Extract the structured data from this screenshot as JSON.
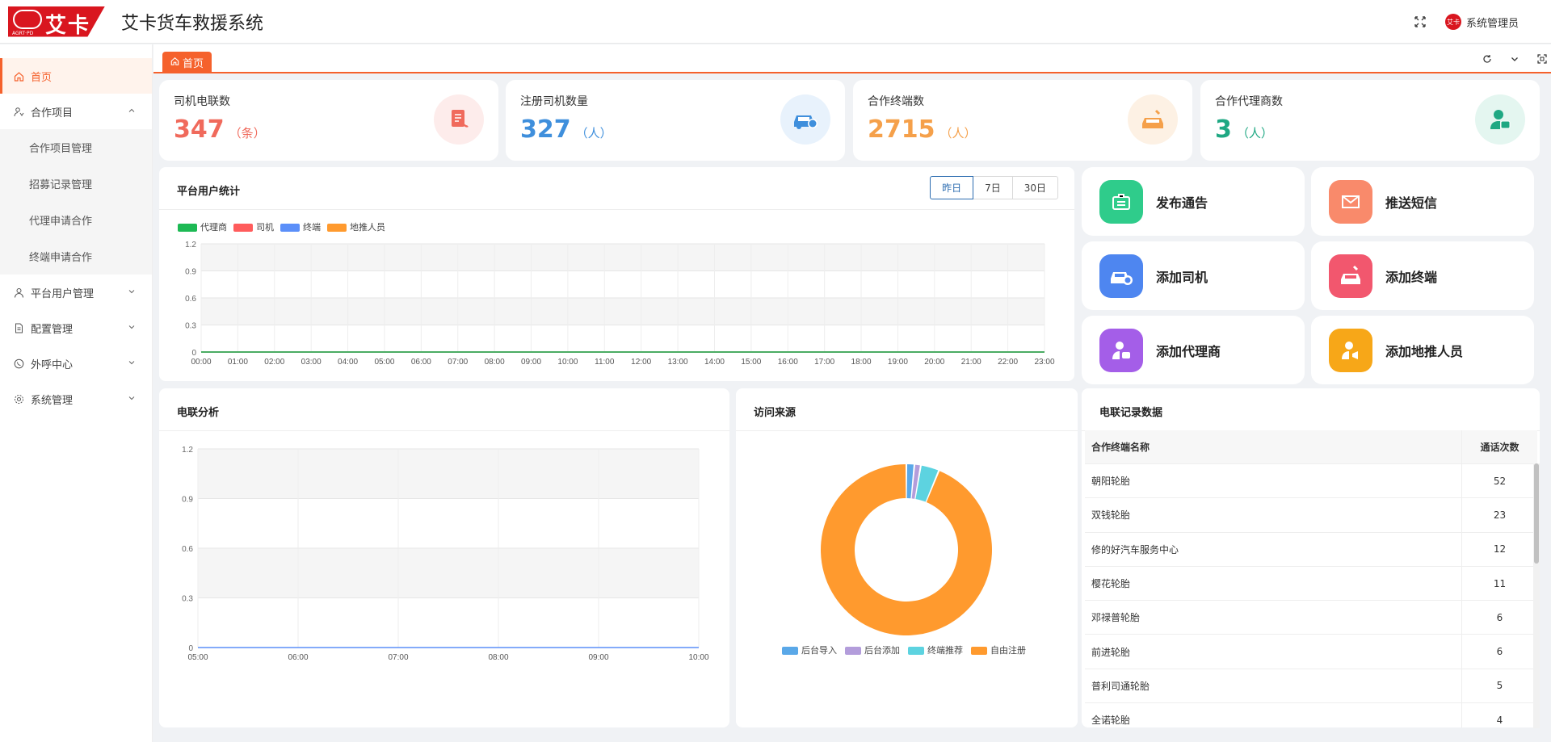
{
  "app": {
    "title": "艾卡货车救援系统",
    "logo_text": "艾卡",
    "logo_sub": "AGRT·PD",
    "user": "系统管理员",
    "user_badge": "艾卡"
  },
  "sidebar": {
    "items": [
      {
        "label": "首页"
      },
      {
        "label": "合作项目",
        "children": [
          "合作项目管理",
          "招募记录管理",
          "代理申请合作",
          "终端申请合作"
        ]
      },
      {
        "label": "平台用户管理"
      },
      {
        "label": "配置管理"
      },
      {
        "label": "外呼中心"
      },
      {
        "label": "系统管理"
      }
    ]
  },
  "tabs": [
    {
      "label": "首页"
    }
  ],
  "stats": [
    {
      "label": "司机电联数",
      "value": "347",
      "unit": "（条）",
      "color": "#f06a5c",
      "bg": "#fdeceb"
    },
    {
      "label": "注册司机数量",
      "value": "327",
      "unit": "（人）",
      "color": "#3f8fdc",
      "bg": "#e8f2fc"
    },
    {
      "label": "合作终端数",
      "value": "2715",
      "unit": "（人）",
      "color": "#f5a04a",
      "bg": "#fdf1e4"
    },
    {
      "label": "合作代理商数",
      "value": "3",
      "unit": "（人）",
      "color": "#1fa883",
      "bg": "#e4f6f0"
    }
  ],
  "user_stats": {
    "title": "平台用户统计",
    "ranges": [
      "昨日",
      "7日",
      "30日"
    ],
    "legend": [
      "代理商",
      "司机",
      "终端",
      "地推人员"
    ],
    "legend_colors": [
      "#1db954",
      "#ff5c5c",
      "#5b8ff9",
      "#ff9a2e"
    ]
  },
  "actions": [
    {
      "label": "发布通告",
      "color": "#2fcc8b",
      "icon": "notice-icon"
    },
    {
      "label": "推送短信",
      "color": "#f98a6b",
      "icon": "mail-icon"
    },
    {
      "label": "添加司机",
      "color": "#4e86f0",
      "icon": "car-icon"
    },
    {
      "label": "添加终端",
      "color": "#f2576e",
      "icon": "car-repair-icon"
    },
    {
      "label": "添加代理商",
      "color": "#a45ee8",
      "icon": "agent-icon"
    },
    {
      "label": "添加地推人员",
      "color": "#f7a718",
      "icon": "promoter-icon"
    }
  ],
  "call_analysis": {
    "title": "电联分析"
  },
  "visit_source": {
    "title": "访问来源",
    "legend": [
      "后台导入",
      "后台添加",
      "终端推荐",
      "自由注册"
    ],
    "legend_colors": [
      "#5aa8e8",
      "#b39ddb",
      "#5dd3e0",
      "#ff9a2e"
    ]
  },
  "call_records": {
    "title": "电联记录数据",
    "headers": [
      "合作终端名称",
      "通话次数"
    ],
    "rows": [
      [
        "朝阳轮胎",
        "52"
      ],
      [
        "双钱轮胎",
        "23"
      ],
      [
        "修的好汽车服务中心",
        "12"
      ],
      [
        "樱花轮胎",
        "11"
      ],
      [
        "邓禄普轮胎",
        "6"
      ],
      [
        "前进轮胎",
        "6"
      ],
      [
        "普利司通轮胎",
        "5"
      ],
      [
        "全诺轮胎",
        "4"
      ]
    ]
  },
  "chart_data": [
    {
      "type": "line",
      "title": "平台用户统计",
      "x": [
        "00:00",
        "01:00",
        "02:00",
        "03:00",
        "04:00",
        "05:00",
        "06:00",
        "07:00",
        "08:00",
        "09:00",
        "10:00",
        "11:00",
        "12:00",
        "13:00",
        "14:00",
        "15:00",
        "16:00",
        "17:00",
        "18:00",
        "19:00",
        "20:00",
        "21:00",
        "22:00",
        "23:00"
      ],
      "ylim": [
        0,
        1.2
      ],
      "yticks": [
        "1.2",
        "0.9",
        "0.6",
        "0.3",
        "0"
      ],
      "series": [
        {
          "name": "代理商",
          "values": [
            0,
            0,
            0,
            0,
            0,
            0,
            0,
            0,
            0,
            0,
            0,
            0,
            0,
            0,
            0,
            0,
            0,
            0,
            0,
            0,
            0,
            0,
            0,
            0
          ]
        },
        {
          "name": "司机",
          "values": [
            0,
            0,
            0,
            0,
            0,
            0,
            0,
            0,
            0,
            0,
            0,
            0,
            0,
            0,
            0,
            0,
            0,
            0,
            0,
            0,
            0,
            0,
            0,
            0
          ]
        },
        {
          "name": "终端",
          "values": [
            0,
            0,
            0,
            0,
            0,
            0,
            0,
            0,
            0,
            0,
            0,
            0,
            0,
            0,
            0,
            0,
            0,
            0,
            0,
            0,
            0,
            0,
            0,
            0
          ]
        },
        {
          "name": "地推人员",
          "values": [
            0,
            0,
            0,
            0,
            0,
            0,
            0,
            0,
            0,
            0,
            0,
            0,
            0,
            0,
            0,
            0,
            0,
            0,
            0,
            0,
            0,
            0,
            0,
            0
          ]
        }
      ]
    },
    {
      "type": "line",
      "title": "电联分析",
      "x": [
        "05:00",
        "06:00",
        "07:00",
        "08:00",
        "09:00",
        "10:00"
      ],
      "ylim": [
        0,
        1.2
      ],
      "yticks": [
        "1.2",
        "0.9",
        "0.6",
        "0.3",
        "0"
      ],
      "series": [
        {
          "values": [
            0,
            0,
            0,
            0,
            0,
            0
          ]
        }
      ]
    },
    {
      "type": "pie",
      "title": "访问来源",
      "categories": [
        "后台导入",
        "后台添加",
        "终端推荐",
        "自由注册"
      ],
      "values": [
        1.5,
        1.2,
        3.5,
        93.8
      ]
    }
  ]
}
